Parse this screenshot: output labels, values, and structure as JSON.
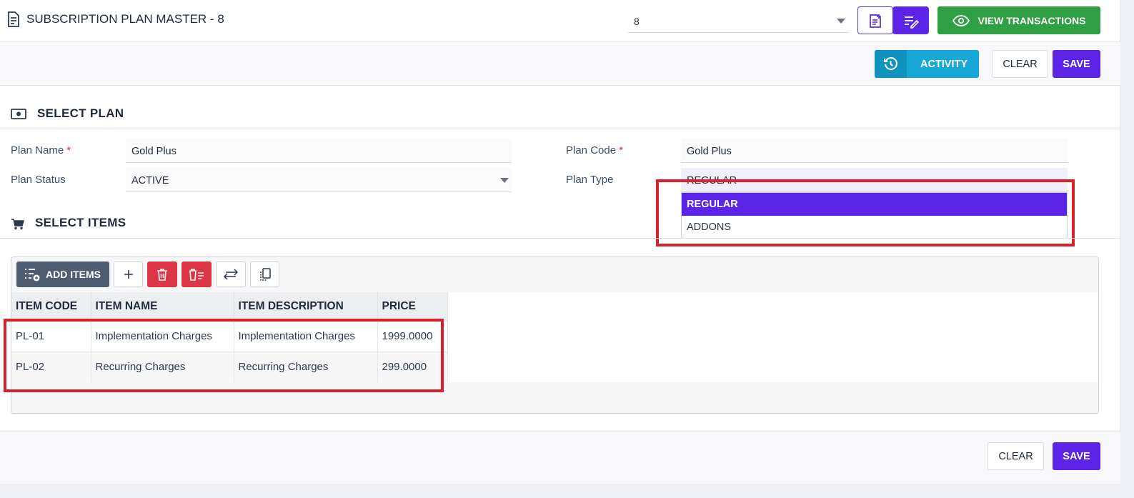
{
  "header": {
    "title": "SUBSCRIPTION PLAN MASTER - 8",
    "record_select_value": "8",
    "view_transactions_label": "VIEW TRANSACTIONS"
  },
  "actions": {
    "activity_label": "ACTIVITY",
    "clear_label": "CLEAR",
    "save_label": "SAVE"
  },
  "plan_section": {
    "title": "SELECT PLAN",
    "plan_name_label": "Plan Name",
    "plan_name_value": "Gold Plus",
    "plan_code_label": "Plan Code",
    "plan_code_value": "Gold Plus",
    "plan_status_label": "Plan Status",
    "plan_status_value": "ACTIVE",
    "plan_type_label": "Plan Type",
    "plan_type_value": "REGULAR",
    "required_mark": "*",
    "plan_type_options": [
      "REGULAR",
      "ADDONS"
    ]
  },
  "items_section": {
    "title": "SELECT ITEMS",
    "add_items_label": "ADD ITEMS",
    "columns": [
      "ITEM CODE",
      "ITEM NAME",
      "ITEM DESCRIPTION",
      "PRICE"
    ],
    "rows": [
      [
        "PL-01",
        "Implementation Charges",
        "Implementation Charges",
        "1999.0000"
      ],
      [
        "PL-02",
        "Recurring Charges",
        "Recurring Charges",
        "299.0000"
      ]
    ]
  },
  "footer": {
    "clear_label": "CLEAR",
    "save_label": "SAVE"
  },
  "colors": {
    "primary": "#5b24e6",
    "success": "#2ea043",
    "info": "#17a8d8",
    "danger": "#dc3545",
    "highlight": "#d8212b"
  }
}
